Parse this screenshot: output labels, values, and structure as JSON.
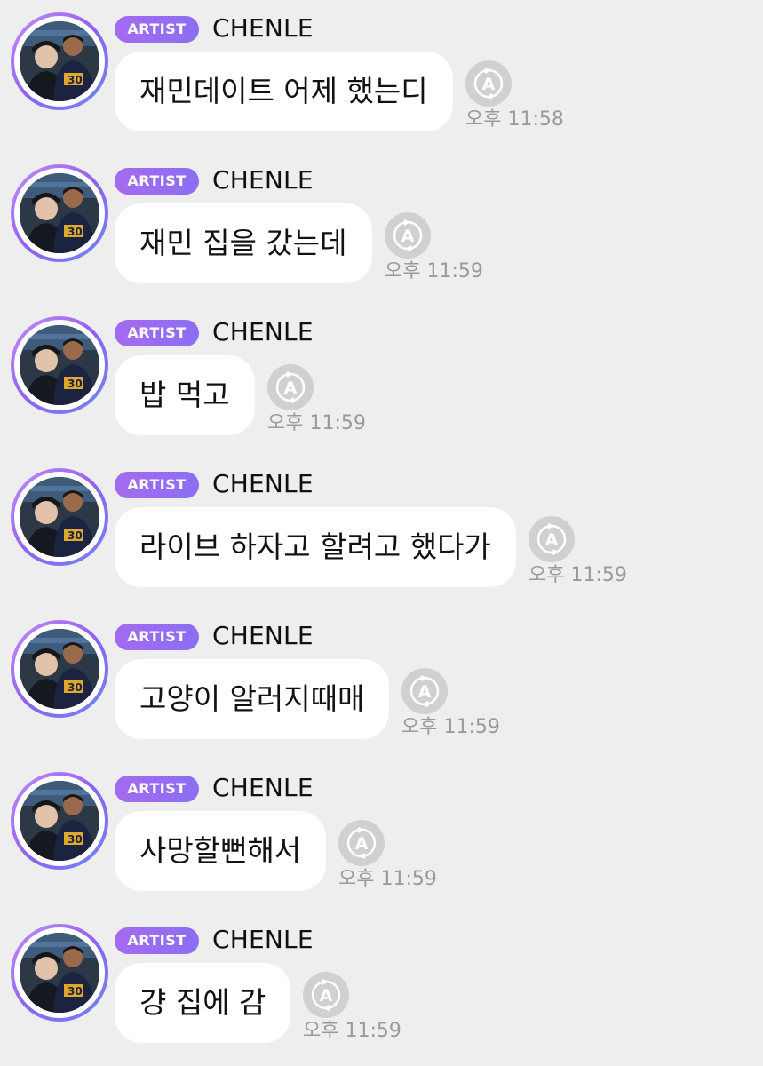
{
  "messages": [
    {
      "badge": "ARTIST",
      "sender": "CHENLE",
      "text": "재민데이트 어제 했는디",
      "time": "오후 11:58"
    },
    {
      "badge": "ARTIST",
      "sender": "CHENLE",
      "text": "재민 집을 갔는데",
      "time": "오후 11:59"
    },
    {
      "badge": "ARTIST",
      "sender": "CHENLE",
      "text": "밥 먹고",
      "time": "오후 11:59"
    },
    {
      "badge": "ARTIST",
      "sender": "CHENLE",
      "text": "라이브 하자고 할려고 했다가",
      "time": "오후 11:59"
    },
    {
      "badge": "ARTIST",
      "sender": "CHENLE",
      "text": "고양이 알러지때매",
      "time": "오후 11:59"
    },
    {
      "badge": "ARTIST",
      "sender": "CHENLE",
      "text": "사망할뻔해서",
      "time": "오후 11:59"
    },
    {
      "badge": "ARTIST",
      "sender": "CHENLE",
      "text": "걍 집에 감",
      "time": "오후 11:59"
    }
  ],
  "icons": {
    "avatar": "profile-photo",
    "translate": "auto-translate-icon"
  },
  "colors": {
    "background": "#eeeeee",
    "badge": "#9b6cf2",
    "bubble": "#ffffff",
    "timestamp": "#9a9a9a",
    "translate_icon": "#d0d0d0"
  }
}
